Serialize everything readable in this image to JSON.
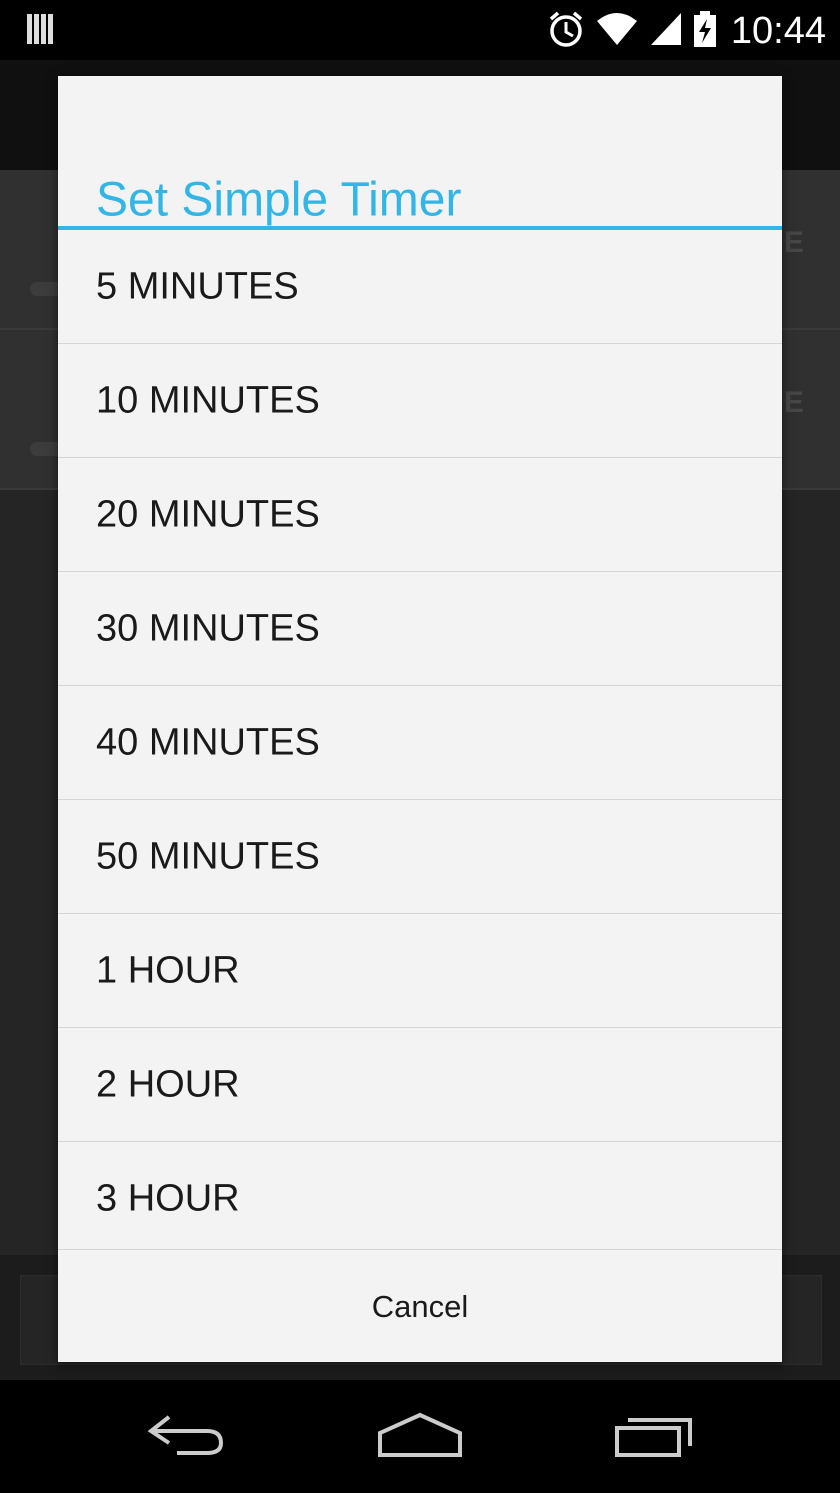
{
  "status_bar": {
    "time": "10:44",
    "icons": [
      "signal-bars-icon",
      "alarm-icon",
      "wifi-icon",
      "cell-signal-icon",
      "battery-charging-icon"
    ]
  },
  "background_app": {
    "list_items": [
      {
        "trailing_text": "E"
      },
      {
        "trailing_text": "E"
      }
    ]
  },
  "dialog": {
    "title": "Set Simple Timer",
    "accent_color": "#33b5e5",
    "options": [
      "5 MINUTES",
      "10 MINUTES",
      "20 MINUTES",
      "30 MINUTES",
      "40 MINUTES",
      "50 MINUTES",
      "1 HOUR",
      "2 HOUR",
      "3 HOUR"
    ],
    "cancel_label": "Cancel"
  },
  "nav_bar": {
    "buttons": [
      "back-icon",
      "home-icon",
      "recents-icon"
    ]
  }
}
